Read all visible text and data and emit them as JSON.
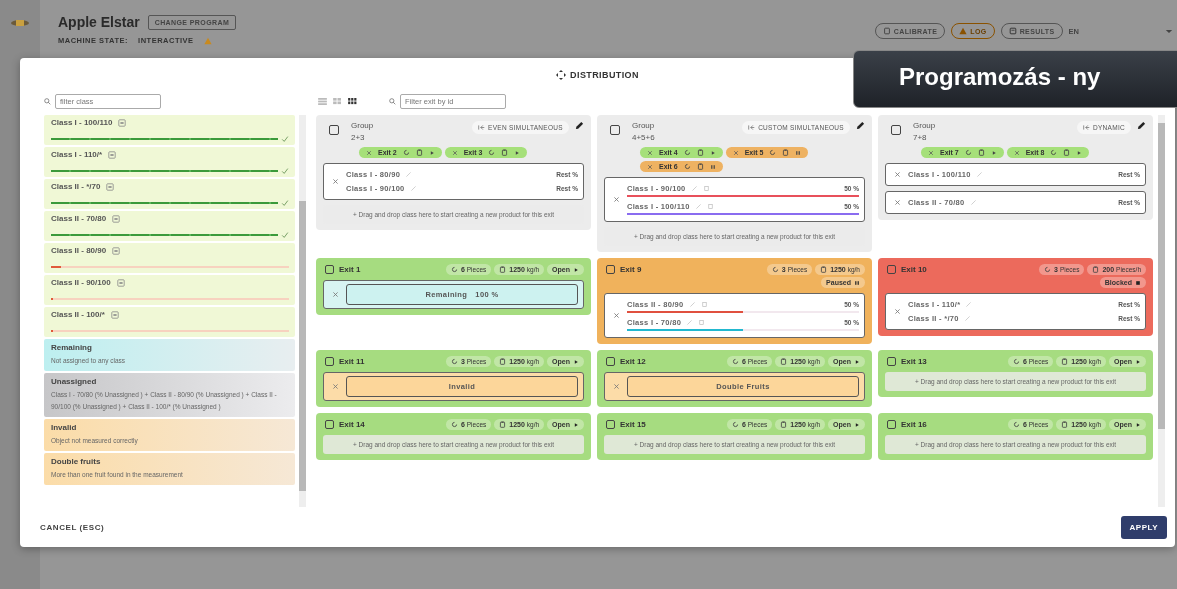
{
  "app": {
    "title": "Apple Elstar",
    "change_program": "CHANGE PROGRAM",
    "machine_state_label": "MACHINE STATE:",
    "machine_state": "INTERACTIVE",
    "buttons": [
      {
        "kind": "calibrate",
        "label": "CALIBRATE"
      },
      {
        "kind": "log",
        "label": "LOG"
      },
      {
        "kind": "results",
        "label": "RESULTS"
      }
    ],
    "language": "EN"
  },
  "dialog": {
    "title": "DISTRIBUTION",
    "class_filter": {
      "placeholder": "filter class"
    },
    "exit_filter": {
      "placeholder": "Filter exit by id"
    },
    "view_modes": [
      {
        "kind": "list",
        "selected": false
      },
      {
        "kind": "grid",
        "selected": false
      },
      {
        "kind": "dense",
        "selected": true
      }
    ],
    "classes": [
      {
        "name": "Class I - 100/110",
        "level": 1
      },
      {
        "name": "Class I - 110/*",
        "level": 1
      },
      {
        "name": "Class II - */70",
        "level": 1
      },
      {
        "name": "Class II - 70/80",
        "level": 1
      },
      {
        "name": "Class II - 80/90",
        "level": 0.04
      },
      {
        "name": "Class II - 90/100",
        "level": 0
      },
      {
        "name": "Class II - 100/*",
        "level": 0
      }
    ],
    "special_classes": [
      {
        "kind": "remaining",
        "title": "Remaining",
        "description": "Not assigned to any class"
      },
      {
        "kind": "unassigned",
        "title": "Unassigned",
        "description": "Class I - 70/80 (% Unassigned ) + Class II - 80/90 (% Unassigned ) + Class II - 90/100 (% Unassigned ) + Class II - 100/* (% Unassigned )"
      },
      {
        "kind": "invalid",
        "title": "Invalid",
        "description": "Object not measured correctly"
      },
      {
        "kind": "double",
        "title": "Double fruits",
        "description": "More than one fruit found in the measurement"
      }
    ],
    "cards": [
      {
        "kind": "group",
        "checked": false,
        "title": "Group",
        "ids": "2+3",
        "mode": "EVEN SIMULTANEOUS",
        "exits": [
          {
            "label": "Exit 2",
            "paused": false
          },
          {
            "label": "Exit 3",
            "paused": false
          }
        ],
        "products": [
          {
            "kind": "classes",
            "items": [
              {
                "name": "Class I - 80/90",
                "share": "Rest %"
              },
              {
                "name": "Class I - 90/100",
                "share": "Rest %"
              }
            ]
          }
        ],
        "drop_hint": "+ Drag and drop class here to start creating a new product for this exit"
      },
      {
        "kind": "group",
        "checked": false,
        "title": "Group",
        "ids": "4+5+6",
        "mode": "CUSTOM SIMULTANEOUS",
        "exits": [
          {
            "label": "Exit 4",
            "paused": false
          },
          {
            "label": "Exit 5",
            "paused": true
          },
          {
            "label": "Exit 6",
            "paused": true
          }
        ],
        "products": [
          {
            "kind": "classes",
            "items": [
              {
                "name": "Class I - 90/100",
                "share": "50 %",
                "color": "#e8505b",
                "level": 1
              },
              {
                "name": "Class I - 100/110",
                "share": "50 %",
                "color": "#8a6cf0",
                "level": 1
              }
            ]
          }
        ],
        "drop_hint": "+ Drag and drop class here to start creating a new product for this exit"
      },
      {
        "kind": "group",
        "checked": false,
        "title": "Group",
        "ids": "7+8",
        "mode": "DYNAMIC",
        "exits": [
          {
            "label": "Exit 7",
            "paused": false
          },
          {
            "label": "Exit 8",
            "paused": false
          }
        ],
        "products": [
          {
            "kind": "classes",
            "items": [
              {
                "name": "Class I - 100/110",
                "share": "Rest %"
              }
            ]
          },
          {
            "kind": "classes",
            "items": [
              {
                "name": "Class II - 70/80",
                "share": "Rest %"
              }
            ]
          }
        ]
      },
      {
        "kind": "exit",
        "checked": false,
        "title": "Exit 1",
        "color": "#a6dc80",
        "pieces": "6",
        "pieces_unit": "Pieces",
        "rate": "1250",
        "rate_unit": "kg/h",
        "status": {
          "kind": "open",
          "label": "Open"
        },
        "products": [
          {
            "kind": "remaining",
            "label": "Remaining",
            "value": "100 %"
          }
        ]
      },
      {
        "kind": "exit",
        "checked": false,
        "title": "Exit 9",
        "color": "#f0b25c",
        "pieces": "3",
        "pieces_unit": "Pieces",
        "rate": "1250",
        "rate_unit": "kg/h",
        "status": {
          "kind": "paused",
          "label": "Paused"
        },
        "products": [
          {
            "kind": "classes",
            "items": [
              {
                "name": "Class II - 80/90",
                "share": "50 %",
                "color": "#e0503f",
                "level": 0.5
              },
              {
                "name": "Class I - 70/80",
                "share": "50 %",
                "color": "#22b8cf",
                "level": 0.5
              }
            ]
          }
        ]
      },
      {
        "kind": "exit",
        "checked": false,
        "title": "Exit 10",
        "color": "#ec6a5c",
        "pieces": "3",
        "pieces_unit": "Pieces",
        "rate": "200",
        "rate_unit": "Pieces/h",
        "status": {
          "kind": "blocked",
          "label": "Blocked"
        },
        "products": [
          {
            "kind": "classes",
            "items": [
              {
                "name": "Class I - 110/*",
                "share": "Rest %"
              },
              {
                "name": "Class II - */70",
                "share": "Rest %"
              }
            ]
          }
        ]
      },
      {
        "kind": "exit",
        "checked": false,
        "title": "Exit 11",
        "color": "#a6dc80",
        "pieces": "3",
        "pieces_unit": "Pieces",
        "rate": "1250",
        "rate_unit": "kg/h",
        "status": {
          "kind": "open",
          "label": "Open"
        },
        "products": [
          {
            "kind": "invalid",
            "label": "Invalid"
          }
        ]
      },
      {
        "kind": "exit",
        "checked": false,
        "title": "Exit 12",
        "color": "#a6dc80",
        "pieces": "6",
        "pieces_unit": "Pieces",
        "rate": "1250",
        "rate_unit": "kg/h",
        "status": {
          "kind": "open",
          "label": "Open"
        },
        "products": [
          {
            "kind": "invalid",
            "label": "Double Fruits"
          }
        ]
      },
      {
        "kind": "exit",
        "checked": false,
        "title": "Exit 13",
        "color": "#a6dc80",
        "pieces": "6",
        "pieces_unit": "Pieces",
        "rate": "1250",
        "rate_unit": "kg/h",
        "status": {
          "kind": "open",
          "label": "Open"
        },
        "drop_hint": "+ Drag and drop class here to start creating a new product for this exit"
      },
      {
        "kind": "exit",
        "checked": false,
        "title": "Exit 14",
        "color": "#a6dc80",
        "pieces": "6",
        "pieces_unit": "Pieces",
        "rate": "1250",
        "rate_unit": "kg/h",
        "status": {
          "kind": "open",
          "label": "Open"
        },
        "drop_hint": "+ Drag and drop class here to start creating a new product for this exit"
      },
      {
        "kind": "exit",
        "checked": false,
        "title": "Exit 15",
        "color": "#a6dc80",
        "pieces": "6",
        "pieces_unit": "Pieces",
        "rate": "1250",
        "rate_unit": "kg/h",
        "status": {
          "kind": "open",
          "label": "Open"
        },
        "drop_hint": "+ Drag and drop class here to start creating a new product for this exit"
      },
      {
        "kind": "exit",
        "checked": false,
        "title": "Exit 16",
        "color": "#a6dc80",
        "pieces": "6",
        "pieces_unit": "Pieces",
        "rate": "1250",
        "rate_unit": "kg/h",
        "status": {
          "kind": "open",
          "label": "Open"
        },
        "drop_hint": "+ Drag and drop class here to start creating a new product for this exit"
      }
    ],
    "cancel": "CANCEL (ESC)",
    "apply": "APPLY"
  },
  "banner": {
    "text": "Programozás - ny"
  }
}
